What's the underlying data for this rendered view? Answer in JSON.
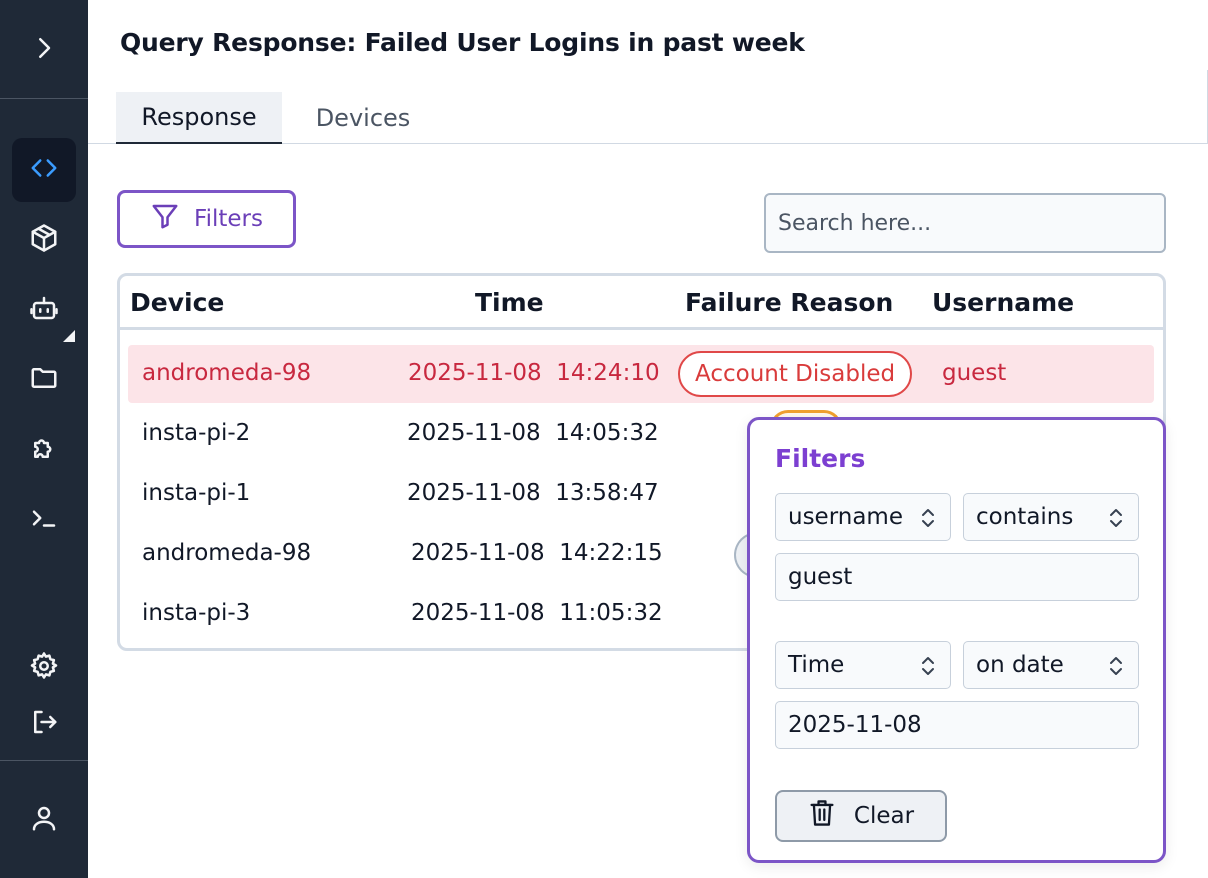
{
  "sidebar": {
    "top_icon": "chevron-right-icon",
    "items": [
      {
        "icon": "code-icon",
        "active": true
      },
      {
        "icon": "cube-icon",
        "active": false
      },
      {
        "icon": "robot-icon",
        "active": false
      },
      {
        "icon": "folder-icon",
        "active": false
      },
      {
        "icon": "puzzle-icon",
        "active": false
      },
      {
        "icon": "terminal-icon",
        "active": false
      }
    ],
    "bottom_items": [
      {
        "icon": "gear-icon"
      },
      {
        "icon": "logout-icon"
      },
      {
        "icon": "user-icon"
      }
    ],
    "colors": {
      "background": "#1f2937",
      "active_icon": "#3b9cff"
    }
  },
  "header": {
    "title": "Query Response: Failed User Logins in past week"
  },
  "tabs": [
    {
      "label": "Response",
      "active": true
    },
    {
      "label": "Devices",
      "active": false
    }
  ],
  "toolbar": {
    "filters_label": "Filters",
    "search_placeholder": "Search here..."
  },
  "table": {
    "columns": [
      "Device",
      "Time",
      "Failure Reason",
      "Username"
    ],
    "rows": [
      {
        "device": "andromeda-98",
        "time": "2025-11-08  14:24:10",
        "reason": "Account Disabled",
        "username": "guest",
        "highlighted": true
      },
      {
        "device": "insta-pi-2",
        "time": "2025-11-08  14:05:32"
      },
      {
        "device": "insta-pi-1",
        "time": "2025-11-08  13:58:47"
      },
      {
        "device": "andromeda-98",
        "time": "2025-11-08  14:22:15"
      },
      {
        "device": "insta-pi-3",
        "time": "2025-11-08  11:05:32"
      }
    ]
  },
  "filter_panel": {
    "title": "Filters",
    "filters": [
      {
        "field": "username",
        "operator": "contains",
        "value": "guest"
      },
      {
        "field": "Time",
        "operator": "on date",
        "value": "2025-11-08"
      }
    ],
    "clear_label": "Clear"
  },
  "colors": {
    "accent_purple": "#7c55c7",
    "error_red": "#d93b3b",
    "highlight_row": "#fce4e8"
  }
}
